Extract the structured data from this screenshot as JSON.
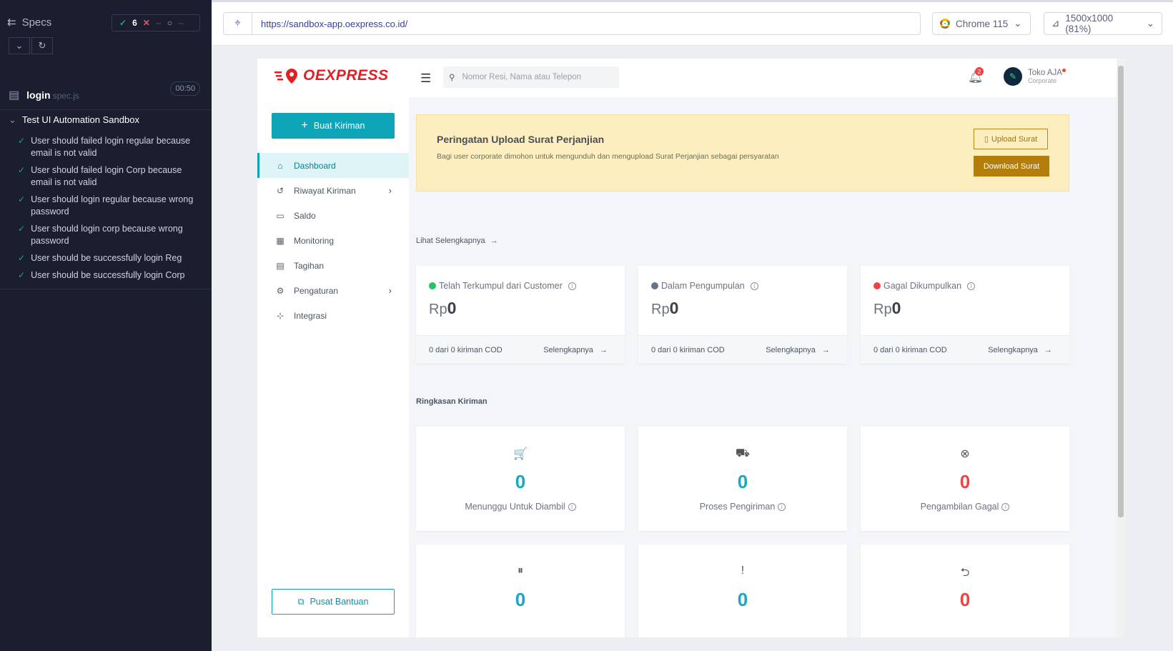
{
  "runner": {
    "title": "Specs",
    "stats": {
      "passed": "6",
      "failed": "--",
      "pending": "--"
    },
    "spec": {
      "name": "login",
      "ext": "spec.js",
      "time": "00:50"
    },
    "suite": "Test UI Automation Sandbox",
    "tests": [
      "User should failed login regular because email is not valid",
      "User should failed login Corp because email is not valid",
      "User should login regular because wrong password",
      "User should login corp because wrong password",
      "User should be successfully login Reg",
      "User should be successfully login Corp"
    ]
  },
  "browser": {
    "url": "https://sandbox-app.oexpress.co.id/",
    "browser_name": "Chrome 115",
    "viewport": "1500x1000 (81%)"
  },
  "app": {
    "logo": "OEXPRESS",
    "new_button": "Buat Kiriman",
    "menu": [
      {
        "label": "Dashboard",
        "icon": "home-icon",
        "glyph": "⌂"
      },
      {
        "label": "Riwayat Kiriman",
        "icon": "history-icon",
        "glyph": "↺"
      },
      {
        "label": "Saldo",
        "icon": "wallet-icon",
        "glyph": "▭"
      },
      {
        "label": "Monitoring",
        "icon": "calendar-icon",
        "glyph": "▦"
      },
      {
        "label": "Tagihan",
        "icon": "card-icon",
        "glyph": "▤"
      },
      {
        "label": "Pengaturan",
        "icon": "gear-icon",
        "glyph": "⚙"
      },
      {
        "label": "Integrasi",
        "icon": "network-icon",
        "glyph": "⊹"
      }
    ],
    "help_button": "Pusat Bantuan",
    "search_placeholder": "Nomor Resi, Nama atau Telepon",
    "notif_count": "2",
    "user": {
      "name": "Toko AJA",
      "role": "Corporate"
    },
    "warning": {
      "title": "Peringatan Upload Surat Perjanjian",
      "desc": "Bagi user corporate dimohon untuk mengunduh dan mengupload Surat Perjanjian sebagai persyaratan",
      "upload_label": "Upload Surat",
      "download_label": "Download Surat"
    },
    "see_more": "Lihat Selengkapnya",
    "cod": [
      {
        "label": "Telah Terkumpul dari Customer",
        "currency": "Rp",
        "amount": "0",
        "footer": "0 dari 0 kiriman COD",
        "more": "Selengkapnya",
        "status_color": "#22c55e"
      },
      {
        "label": "Dalam Pengumpulan",
        "currency": "Rp",
        "amount": "0",
        "footer": "0 dari 0 kiriman COD",
        "more": "Selengkapnya",
        "status_color": "#64748b"
      },
      {
        "label": "Gagal Dikumpulkan",
        "currency": "Rp",
        "amount": "0",
        "footer": "0 dari 0 kiriman COD",
        "more": "Selengkapnya",
        "status_color": "#ef4444"
      }
    ],
    "summary_title": "Ringkasan Kiriman",
    "summary": [
      {
        "label": "Menunggu Untuk Diambil",
        "value": "0",
        "icon": "cart-icon",
        "glyph": "🛒",
        "color": "#1aa7c0"
      },
      {
        "label": "Proses Pengiriman",
        "value": "0",
        "icon": "truck-icon",
        "glyph": "⛟",
        "color": "#1aa7c0"
      },
      {
        "label": "Pengambilan Gagal",
        "value": "0",
        "icon": "x-circle-icon",
        "glyph": "⊗",
        "color": "#ef4444"
      },
      {
        "label": "",
        "value": "0",
        "icon": "pause-icon",
        "glyph": "⏸",
        "color": "#1aa7c0"
      },
      {
        "label": "",
        "value": "0",
        "icon": "alert-icon",
        "glyph": "!",
        "color": "#1aa7c0"
      },
      {
        "label": "",
        "value": "0",
        "icon": "return-icon",
        "glyph": "⮌",
        "color": "#ef4444"
      }
    ]
  }
}
